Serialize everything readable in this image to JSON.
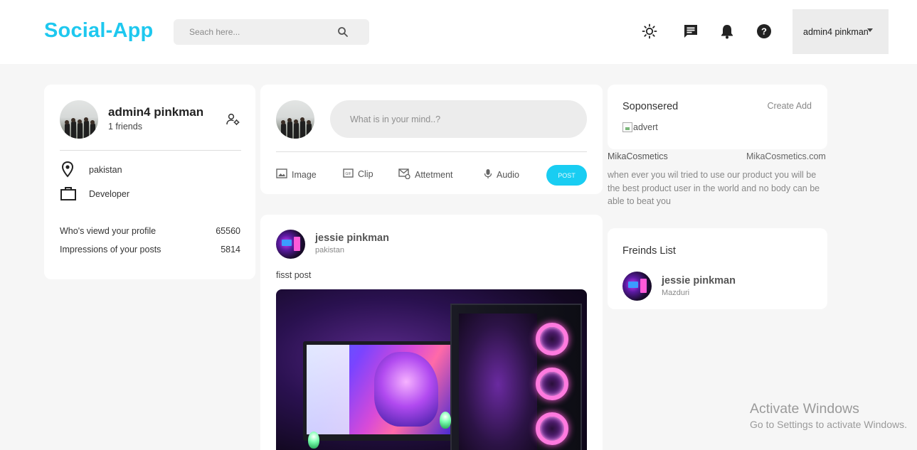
{
  "app": {
    "title": "Social-App",
    "brand_color": "#1ec8ef"
  },
  "search": {
    "placeholder": "Seach here...",
    "icon": "search-icon"
  },
  "header": {
    "icons": [
      "sun-icon",
      "message-icon",
      "bell-icon",
      "help-icon"
    ],
    "user_menu_label": "admin4 pinkman"
  },
  "profile": {
    "name": "admin4 pinkman",
    "friends": "1 friends",
    "location": "pakistan",
    "job": "Developer",
    "stats": [
      {
        "label": "Who's viewd your profile",
        "value": "65560"
      },
      {
        "label": "Impressions of your posts",
        "value": "5814"
      }
    ]
  },
  "composer": {
    "placeholder": "What is in your mind..?",
    "tools": [
      "Image",
      "Clip",
      "Attetment",
      "Audio"
    ],
    "post_label": "POST",
    "post_color": "#19cdf2"
  },
  "feed": {
    "posts": [
      {
        "author": "jessie pinkman",
        "location": "pakistan",
        "text": "fisst post"
      }
    ]
  },
  "sponsored": {
    "title": "Soponsered",
    "create_label": "Create Add",
    "image_alt": "advert",
    "brand": "MikaCosmetics",
    "site": "MikaCosmetics.com",
    "description": "when ever you wil tried to use our product you will be the best product user in the world and no body can be able to beat you"
  },
  "friends_list": {
    "title": "Freinds List",
    "items": [
      {
        "name": "jessie pinkman",
        "role": "Mazduri"
      }
    ]
  },
  "watermark": {
    "title": "Activate Windows",
    "subtitle": "Go to Settings to activate Windows."
  }
}
